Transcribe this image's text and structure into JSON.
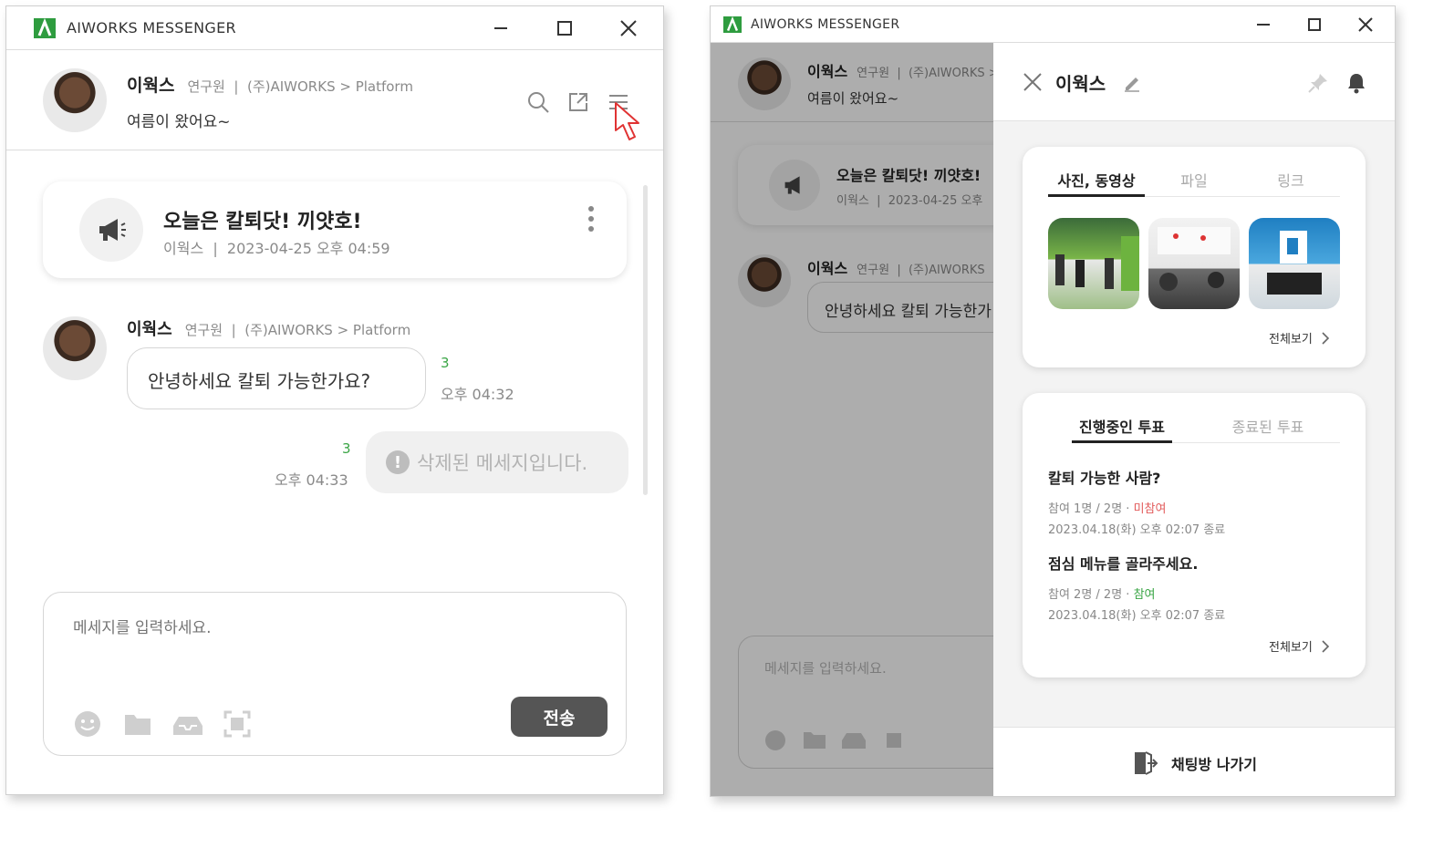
{
  "app": {
    "title": "AIWORKS MESSENGER"
  },
  "colors": {
    "brand": "#2e9c3f",
    "accent_green": "#3aa545",
    "red": "#e25b5b",
    "dark_button": "#555555"
  },
  "left": {
    "header": {
      "name": "이웍스",
      "role_org": "연구원  |  (주)AIWORKS > Platform",
      "status": "여름이 왔어요~"
    },
    "notice": {
      "title": "오늘은 칼퇴닷! 끼얏호!",
      "meta": "이웍스  |  2023-04-25 오후 04:59"
    },
    "message": {
      "name": "이웍스",
      "role_org": "연구원  |  (주)AIWORKS > Platform",
      "text": "안녕하세요 칼퇴 가능한가요?",
      "unread": "3",
      "time": "오후 04:32"
    },
    "deleted": {
      "unread": "3",
      "time": "오후 04:33",
      "text": "삭제된 메세지입니다."
    },
    "composer": {
      "placeholder": "메세지를 입력하세요.",
      "send_label": "전송"
    }
  },
  "right": {
    "bg": {
      "name": "이웍스",
      "role_org": "연구원  |  (주)AIWORKS >",
      "status": "여름이 왔어요~",
      "notice_title": "오늘은 칼퇴닷! 끼얏호!",
      "notice_meta": "이웍스  |  2023-04-25 오후",
      "msg_name": "이웍스",
      "msg_role": "연구원  |  (주)AIWORKS",
      "msg_text": "안녕하세요 칼퇴 가능한가",
      "placeholder": "메세지를 입력하세요."
    },
    "panel": {
      "title": "이웍스",
      "media_tabs": [
        "사진, 동영상",
        "파일",
        "링크"
      ],
      "see_all": "전체보기",
      "vote_tabs": [
        "진행중인 투표",
        "종료된 투표"
      ],
      "votes": [
        {
          "title": "칼퇴 가능한 사람?",
          "count": "참여 1명 / 2명 · ",
          "status": "미참여",
          "status_color": "#e25b5b",
          "date": "2023.04.18(화) 오후 02:07 종료"
        },
        {
          "title": "점심 메뉴를 골라주세요.",
          "count": "참여 2명 / 2명 · ",
          "status": "참여",
          "status_color": "#3aa545",
          "date": "2023.04.18(화) 오후 02:07 종료"
        }
      ],
      "leave_label": "채팅방 나가기"
    }
  }
}
